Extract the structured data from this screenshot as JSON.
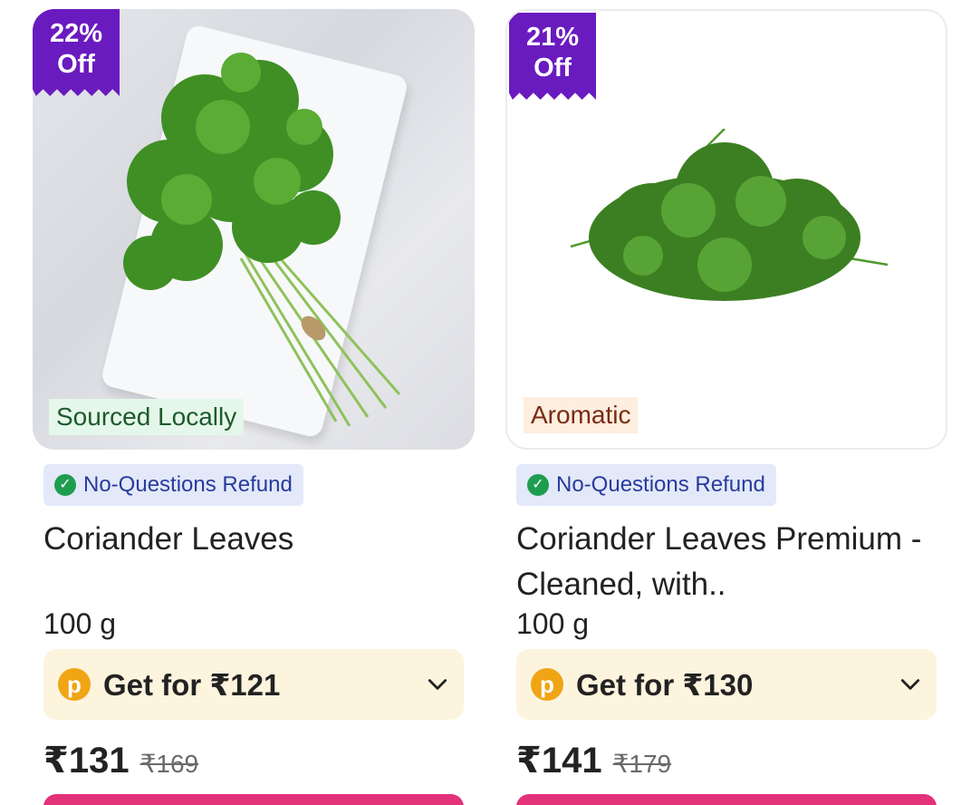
{
  "products": [
    {
      "discount_badge": [
        "22%",
        "Off"
      ],
      "image_tag": "Sourced Locally",
      "refund_label": "No-Questions Refund",
      "name": "Coriander Leaves",
      "weight": "100 g",
      "offer_label": "Get for ₹121",
      "price": "₹131",
      "mrp": "₹169"
    },
    {
      "discount_badge": [
        "21%",
        "Off"
      ],
      "image_tag": "Aromatic",
      "refund_label": "No-Questions Refund",
      "name": "Coriander Leaves Premium - Cleaned, with..",
      "weight": "100 g",
      "offer_label": "Get for ₹130",
      "price": "₹141",
      "mrp": "₹179"
    }
  ],
  "icons": {
    "refund_check": "check-circle-icon",
    "offer_coin": "p-coin-icon",
    "expand": "chevron-down-icon"
  },
  "colors": {
    "badge": "#6a1bbf",
    "refund_bg": "#e3e9f9",
    "refund_text": "#283b9c",
    "check": "#1f9d4f",
    "offer_bg": "#fdf4de",
    "coin": "#f0a515",
    "add_button": "#e3317a"
  }
}
